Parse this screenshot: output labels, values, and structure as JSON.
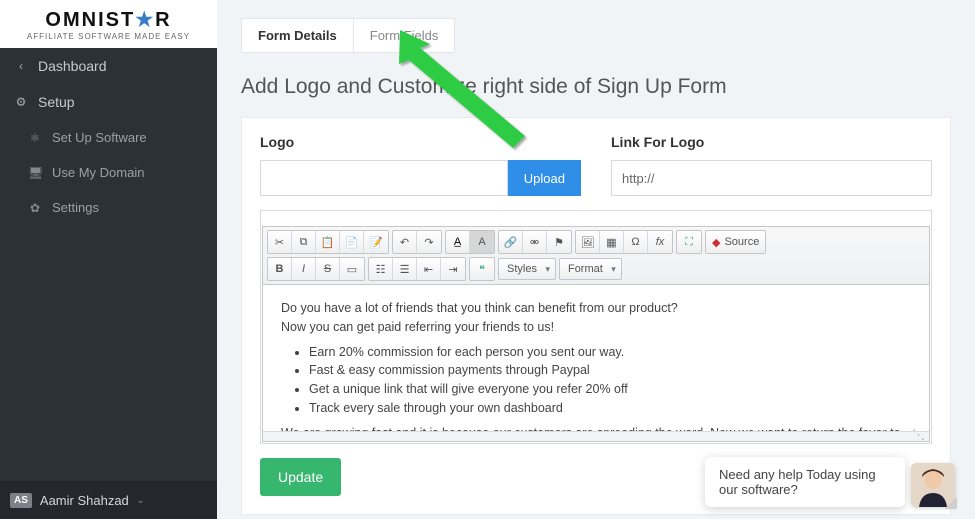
{
  "logo": {
    "brand_main": "OMNIST",
    "brand_star": "★",
    "brand_r": "R",
    "tagline": "AFFILIATE SOFTWARE MADE EASY"
  },
  "sidebar": {
    "items": [
      {
        "icon": "‹",
        "label": "Dashboard"
      },
      {
        "icon": "⚙",
        "label": "Setup"
      }
    ],
    "sub": [
      {
        "icon": "⚛",
        "label": "Set Up Software"
      },
      {
        "icon": "🖥",
        "label": "Use My Domain"
      },
      {
        "icon": "✿",
        "label": "Settings"
      }
    ],
    "user_badge": "AS",
    "user_name": "Aamir Shahzad"
  },
  "tabs": {
    "details": "Form Details",
    "fields": "Form Fields"
  },
  "page_title": "Add Logo and Customize right side of Sign Up Form",
  "form": {
    "logo_label": "Logo",
    "upload_label": "Upload",
    "link_label": "Link For Logo",
    "link_value": "http://",
    "update_label": "Update"
  },
  "editor_toolbar": {
    "styles_label": "Styles",
    "format_label": "Format",
    "source_label": "Source"
  },
  "editor_content": {
    "p1": "Do you have a lot of friends that you think can benefit from our product?",
    "p2": "Now you can get paid referring your friends to us!",
    "bullets": [
      "Earn 20% commission for each person you sent our way.",
      "Fast & easy commission payments through Paypal",
      "Get a unique link that will give everyone you refer 20% off",
      "Track every sale through your own dashboard"
    ],
    "p3": "We are growing fast and it is because our customers are spreading the word. Now we want to return the favor to everyone that has helped us. Start getting paid today!"
  },
  "help": {
    "message": "Need any help Today using our software?"
  }
}
